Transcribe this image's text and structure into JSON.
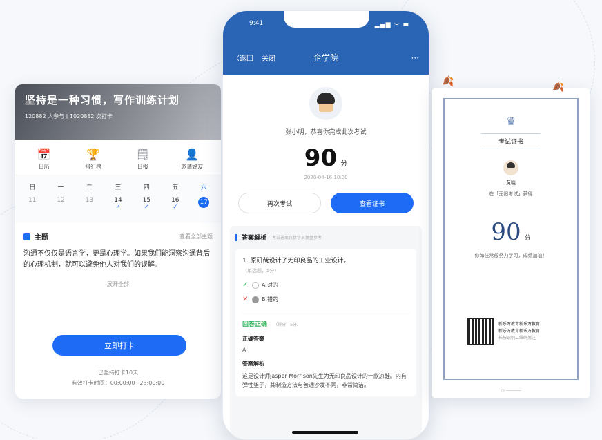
{
  "left_card": {
    "title": "坚持是一种习惯，写作训练计划",
    "subtitle": "120882 人参与 | 1020882 次打卡",
    "icons": [
      {
        "icon": "calendar-icon",
        "label": "日历",
        "glyph": "📅"
      },
      {
        "icon": "trophy-icon",
        "label": "排行榜",
        "glyph": "🏆"
      },
      {
        "icon": "diary-icon",
        "label": "日报",
        "glyph": "🗒"
      },
      {
        "icon": "user-icon",
        "label": "邀请好友",
        "glyph": "👤"
      }
    ],
    "week": [
      {
        "weekday": "日",
        "date": "11",
        "done": false,
        "today": false
      },
      {
        "weekday": "一",
        "date": "12",
        "done": false,
        "today": false
      },
      {
        "weekday": "二",
        "date": "13",
        "done": false,
        "today": false
      },
      {
        "weekday": "三",
        "date": "14",
        "done": true,
        "today": false
      },
      {
        "weekday": "四",
        "date": "15",
        "done": true,
        "today": false
      },
      {
        "weekday": "五",
        "date": "16",
        "done": true,
        "today": false
      },
      {
        "weekday": "六",
        "date": "17",
        "done": false,
        "today": true
      }
    ],
    "check_glyph": "✓",
    "topic_label": "主题",
    "topic_link": "查看全部主题",
    "topic_text": "沟通不仅仅是语言学，更是心理学。如果我们能洞察沟通背后的心理机制，就可以避免他人对我们的误解。",
    "expand_label": "展开全部",
    "checkin_button": "立即打卡",
    "footer_line1": "已坚持打卡10天",
    "footer_line2": "有效打卡时间：00:00:00~23:00:00"
  },
  "phone": {
    "time": "9:41",
    "status": "▂▄▆ ᯤ ▬",
    "back_label": "〈返回",
    "close_label": "关闭",
    "title": "企学院",
    "more": "···",
    "congrats": "张小明，恭喜你完成此次考试",
    "score": "90",
    "score_unit": "分",
    "date": "2020-04-16 10:00",
    "retake_button": "再次考试",
    "certificate_button": "查看证书",
    "analysis_title": "答案解析",
    "analysis_note": "考试答案仅供学员复盘参考",
    "question": "1. 原研哉设计了无印良品的工业设计。",
    "question_type": "（单选题，5分）",
    "option_a": "A.对的",
    "option_b": "B.错的",
    "mark_ok": "✓",
    "mark_no": "✕",
    "answer_status": "回答正确",
    "answer_score": "（得分：5分）",
    "correct_answer_label": "正确答案",
    "correct_answer": "A",
    "explain_label": "答案解析",
    "explain_text": "这是设计师Jasper Morrison先生为无印良品设计的一款凉鞋。内有弹性垫子，其制造方法与普通沙发不同，非常简洁。"
  },
  "certificate": {
    "crown": "♛",
    "title": "考试证书",
    "name": "黄晓",
    "line": "在「无限考试」获得",
    "score": "90",
    "unit": "分",
    "praise": "你如往常般努力学习，成绩加油！",
    "qr_text1": "新乐万教育新乐万教育",
    "qr_text2": "新乐万教育新乐万教育",
    "qr_hint": "长按识别二维码关注",
    "leaf": "🍂"
  }
}
